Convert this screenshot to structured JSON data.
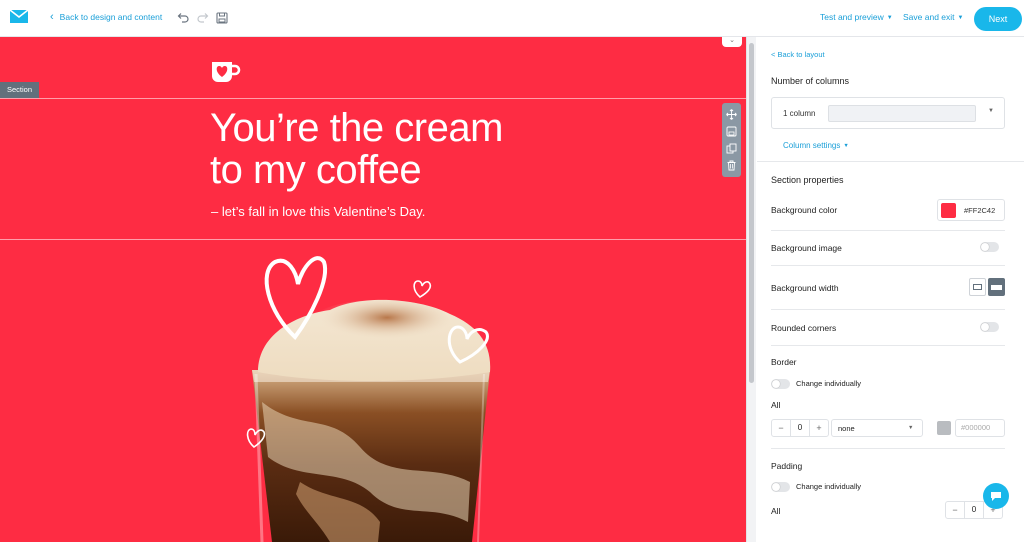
{
  "topbar": {
    "back_label": "Back to design and content",
    "test_preview_label": "Test and preview",
    "save_exit_label": "Save and exit",
    "next_label": "Next"
  },
  "canvas": {
    "section_tag": "Section",
    "headline_line1": "You’re the cream",
    "headline_line2": "to my coffee",
    "subline": "– let’s fall in love this Valentine’s Day.",
    "background_color": "#FE2C43"
  },
  "panel": {
    "back_label": "< Back to layout",
    "number_of_columns_heading": "Number of columns",
    "columns_value": "1 column",
    "column_settings_label": "Column settings",
    "section_properties_heading": "Section properties",
    "background_color_label": "Background color",
    "background_color_value": "#FF2C42",
    "background_image_label": "Background image",
    "background_width_label": "Background width",
    "rounded_corners_label": "Rounded corners",
    "border_heading": "Border",
    "border_change_individually": "Change individually",
    "border_all_label": "All",
    "border_width_value": "0",
    "border_style_value": "none",
    "border_color_placeholder": "#000000",
    "padding_heading": "Padding",
    "padding_change_individually": "Change individually",
    "padding_all_label": "All",
    "padding_value": "0",
    "minus": "−",
    "plus": "+"
  },
  "colors": {
    "accent": "#19B7EA",
    "canvas_red": "#FE2C43"
  },
  "icons": [
    "envelope-logo-icon",
    "undo-icon",
    "redo-icon",
    "save-icon",
    "move-icon",
    "duplicate-icon",
    "delete-icon",
    "heart-mug-icon",
    "chat-icon"
  ]
}
